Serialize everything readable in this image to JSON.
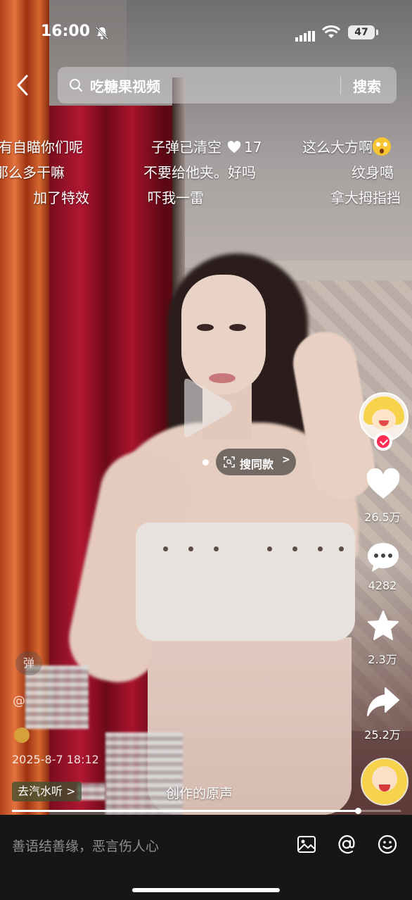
{
  "status_bar": {
    "time": "16:00",
    "battery": "47"
  },
  "search": {
    "query": "吃糖果视频",
    "button_label": "搜索"
  },
  "danmaku": {
    "row1": [
      "有自瞄你们呢",
      "子弹已清空",
      "17",
      "这么大方啊"
    ],
    "row2": [
      "那么多干嘛",
      "不要给他夹。好吗",
      "纹身噶"
    ],
    "row3": [
      "加了特效",
      "吓我一雷",
      "拿大拇指挡"
    ]
  },
  "product_tag": {
    "label": "搜同款",
    "chevron": ">"
  },
  "sidebar": {
    "likes": "26.5万",
    "comments": "4282",
    "favorites": "2.3万",
    "shares": "25.2万"
  },
  "info": {
    "danmaku_toggle": "弹",
    "at_symbol": "@",
    "date": "2025-8-7 18:12",
    "qishui_label": "去汽水听",
    "qishui_chevron": ">",
    "sound_text": "创作的原声"
  },
  "progress": {
    "fraction": 0.89
  },
  "bottom_bar": {
    "comment_placeholder": "善语结善缘，恶言伤人心"
  },
  "colors": {
    "accent": "#fe2c55",
    "bar_bg": "#161616"
  }
}
